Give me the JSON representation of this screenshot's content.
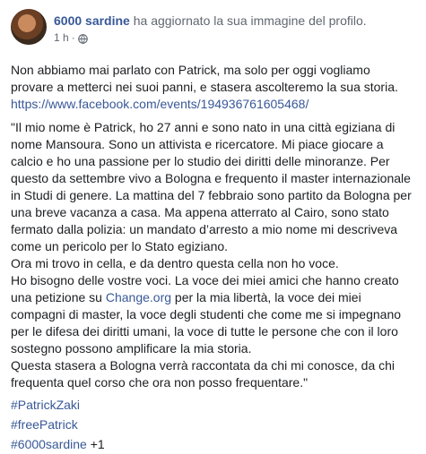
{
  "header": {
    "author": "6000 sardine",
    "action": "ha aggiornato la sua immagine del profilo.",
    "time": "1 h",
    "dot": "·",
    "privacy_icon": "globe-icon"
  },
  "body": {
    "intro": "Non abbiamo mai parlato con Patrick, ma solo per oggi vogliamo provare a metterci nei suoi panni, e stasera ascolteremo la sua storia.",
    "url": "https://www.facebook.com/events/194936761605468/",
    "quote1": "\"Il mio nome è Patrick, ho 27 anni e sono nato in una città egiziana di nome Mansoura. Sono un attivista e ricercatore. Mi piace giocare a calcio e ho una passione per lo studio dei diritti delle minoranze. Per questo da settembre vivo a Bologna e frequento il master internazionale in Studi di genere. La mattina del 7 febbraio sono partito da Bologna per una breve vacanza a casa. Ma appena atterrato al Cairo, sono stato fermato dalla polizia: un mandato d’arresto a mio nome mi descriveva come un pericolo per lo Stato egiziano.",
    "quote2": "Ora mi trovo in cella, e da dentro questa cella non ho voce.",
    "quote3_a": "Ho bisogno delle vostre voci. La voce dei miei amici che hanno creato una petizione su ",
    "quote3_link": "Change.org",
    "quote3_b": " per la mia libertà, la voce dei miei compagni di master, la voce degli studenti che come me si impegnano per le difesa dei diritti umani, la voce di tutte le persone che con il loro sostegno possono amplificare la mia storia.",
    "quote4": "Questa stasera a Bologna verrà raccontata da chi mi conosce, da chi frequenta quel corso che ora non posso frequentare.\"",
    "hashtags": [
      "#PatrickZaki",
      "#freePatrick",
      "#6000sardine"
    ],
    "more_tags": " +1"
  }
}
